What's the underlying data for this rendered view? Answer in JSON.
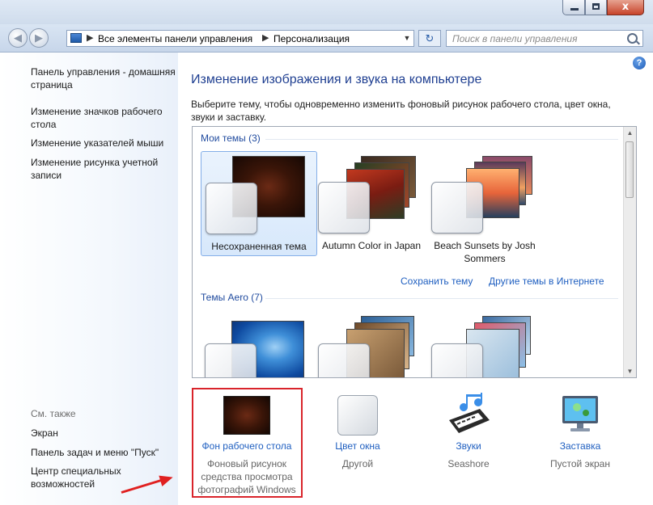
{
  "window": {
    "controls": {
      "close": "x"
    }
  },
  "nav": {
    "breadcrumb": [
      "Все элементы панели управления",
      "Персонализация"
    ],
    "search_placeholder": "Поиск в панели управления"
  },
  "sidebar": {
    "links": [
      "Панель управления - домашняя страница",
      "Изменение значков рабочего стола",
      "Изменение указателей мыши",
      "Изменение рисунка учетной записи"
    ],
    "see_also_title": "См. также",
    "see_also": [
      "Экран",
      "Панель задач и меню \"Пуск\"",
      "Центр специальных возможностей"
    ]
  },
  "main": {
    "title": "Изменение изображения и звука на компьютере",
    "description": "Выберите тему, чтобы одновременно изменить фоновый рисунок рабочего стола, цвет окна, звуки и заставку.",
    "groups": [
      {
        "title": "Мои темы (3)",
        "themes": [
          "Несохраненная тема",
          "Autumn Color in Japan",
          "Beach Sunsets by Josh Sommers"
        ]
      },
      {
        "title": "Темы Aero (7)",
        "themes": []
      }
    ],
    "save_theme_link": "Сохранить тему",
    "online_themes_link": "Другие темы в Интернете"
  },
  "tiles": [
    {
      "title": "Фон рабочего стола",
      "subtitle": "Фоновый рисунок средства просмотра фотографий Windows",
      "icon": "wallpaper-icon"
    },
    {
      "title": "Цвет окна",
      "subtitle": "Другой",
      "icon": "window-color-icon"
    },
    {
      "title": "Звуки",
      "subtitle": "Seashore",
      "icon": "sounds-icon"
    },
    {
      "title": "Заставка",
      "subtitle": "Пустой экран",
      "icon": "screensaver-icon"
    }
  ],
  "colors": {
    "title_blue": "#1f3f91",
    "link_blue": "#1f5fc0",
    "highlight_red": "#d9242b"
  }
}
